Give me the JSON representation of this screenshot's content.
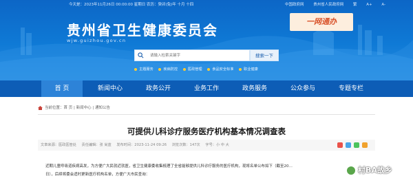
{
  "topbar": {
    "date_text": "今天是：2023年11月26日 00:00:00 星期日  农历：癸卯(兔)年 十月 十四",
    "links": [
      "中国政府网",
      "贵州省人民政府网"
    ],
    "lang_links": [
      "繁",
      "A+",
      "A-"
    ]
  },
  "site": {
    "title": "贵州省卫生健康委员会",
    "domain": "wjw.guizhou.gov.cn",
    "slogan": "一网通办"
  },
  "search": {
    "placeholder": "请输入检索关键字",
    "button": "搜索一下"
  },
  "hotwords": [
    "主题服务",
    "疾病防控",
    "医政管理",
    "食品安全标准",
    "职业健康"
  ],
  "nav": {
    "items": [
      "首 页",
      "新闻中心",
      "政务公开",
      "业务工作",
      "政务服务",
      "公众参与",
      "专题专栏"
    ]
  },
  "breadcrumb": [
    "当前位置：",
    "首 页",
    " | ",
    "新闻中心",
    " | ",
    "通知公告"
  ],
  "article": {
    "title": "可提供儿科诊疗服务医疗机构基本情况调查表",
    "meta": {
      "source": "文章来源：医政医管处",
      "author": "责任编辑：张 尚蓝",
      "publish_time": "发布时间：2023-11-24 09:26",
      "views": "浏览次数：147次",
      "font_size": "字号：小 中 大"
    },
    "paragraphs": [
      "近期儿童呼吸道疾病高发，为方便广大民就近就医，省卫生健康委收集梳理了全省能够提供儿科诊疗服务的医疗机构，现将名单公布如下（截至20…",
      "日），后续将委会适时更新医疗机构名单，方便广大市民查询："
    ]
  },
  "share_colors": [
    "#e9524a",
    "#49a6e8",
    "#4cc35c",
    "#f0a22e"
  ],
  "watermark": {
    "text": "村BA故乡"
  },
  "colors": {
    "header_blue": "#0f7ad6",
    "nav_blue": "#0d5db6",
    "nav_active": "#2d83d8"
  }
}
